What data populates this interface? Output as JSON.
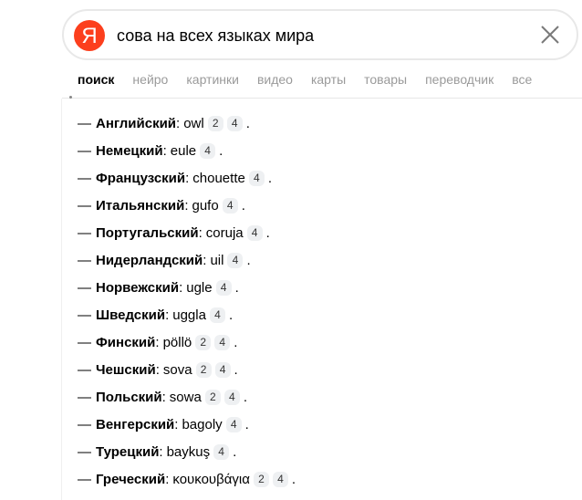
{
  "search": {
    "logo_letter": "Я",
    "query": "сова на всех языках мира",
    "logo_color": "#fc3f1d"
  },
  "tabs": [
    {
      "label": "поиск",
      "active": true
    },
    {
      "label": "нейро"
    },
    {
      "label": "картинки"
    },
    {
      "label": "видео"
    },
    {
      "label": "карты"
    },
    {
      "label": "товары"
    },
    {
      "label": "переводчик"
    },
    {
      "label": "все"
    }
  ],
  "results": [
    {
      "dash": "—",
      "lang": "Английский",
      "word": "owl",
      "refs": [
        "2",
        "4"
      ]
    },
    {
      "dash": "—",
      "lang": "Немецкий",
      "word": "eule",
      "refs": [
        "4"
      ]
    },
    {
      "dash": "—",
      "lang": "Французский",
      "word": "chouette",
      "refs": [
        "4"
      ]
    },
    {
      "dash": "—",
      "lang": "Итальянский",
      "word": "gufo",
      "refs": [
        "4"
      ]
    },
    {
      "dash": "—",
      "lang": "Португальский",
      "word": "coruja",
      "refs": [
        "4"
      ]
    },
    {
      "dash": "—",
      "lang": "Нидерландский",
      "word": "uil",
      "refs": [
        "4"
      ]
    },
    {
      "dash": "—",
      "lang": "Норвежский",
      "word": "ugle",
      "refs": [
        "4"
      ]
    },
    {
      "dash": "—",
      "lang": "Шведский",
      "word": "uggla",
      "refs": [
        "4"
      ]
    },
    {
      "dash": "—",
      "lang": "Финский",
      "word": "pöllö",
      "refs": [
        "2",
        "4"
      ]
    },
    {
      "dash": "—",
      "lang": "Чешский",
      "word": "sova",
      "refs": [
        "2",
        "4"
      ]
    },
    {
      "dash": "—",
      "lang": "Польский",
      "word": "sowa",
      "refs": [
        "2",
        "4"
      ]
    },
    {
      "dash": "—",
      "lang": "Венгерский",
      "word": "bagoly",
      "refs": [
        "4"
      ]
    },
    {
      "dash": "—",
      "lang": "Турецкий",
      "word": "baykuş",
      "refs": [
        "4"
      ]
    },
    {
      "dash": "—",
      "lang": "Греческий",
      "word": "κουκουβάγια",
      "refs": [
        "2",
        "4"
      ]
    }
  ],
  "punct": {
    "colon": ":",
    "period": "."
  },
  "icons": {
    "clear": "close-icon"
  }
}
